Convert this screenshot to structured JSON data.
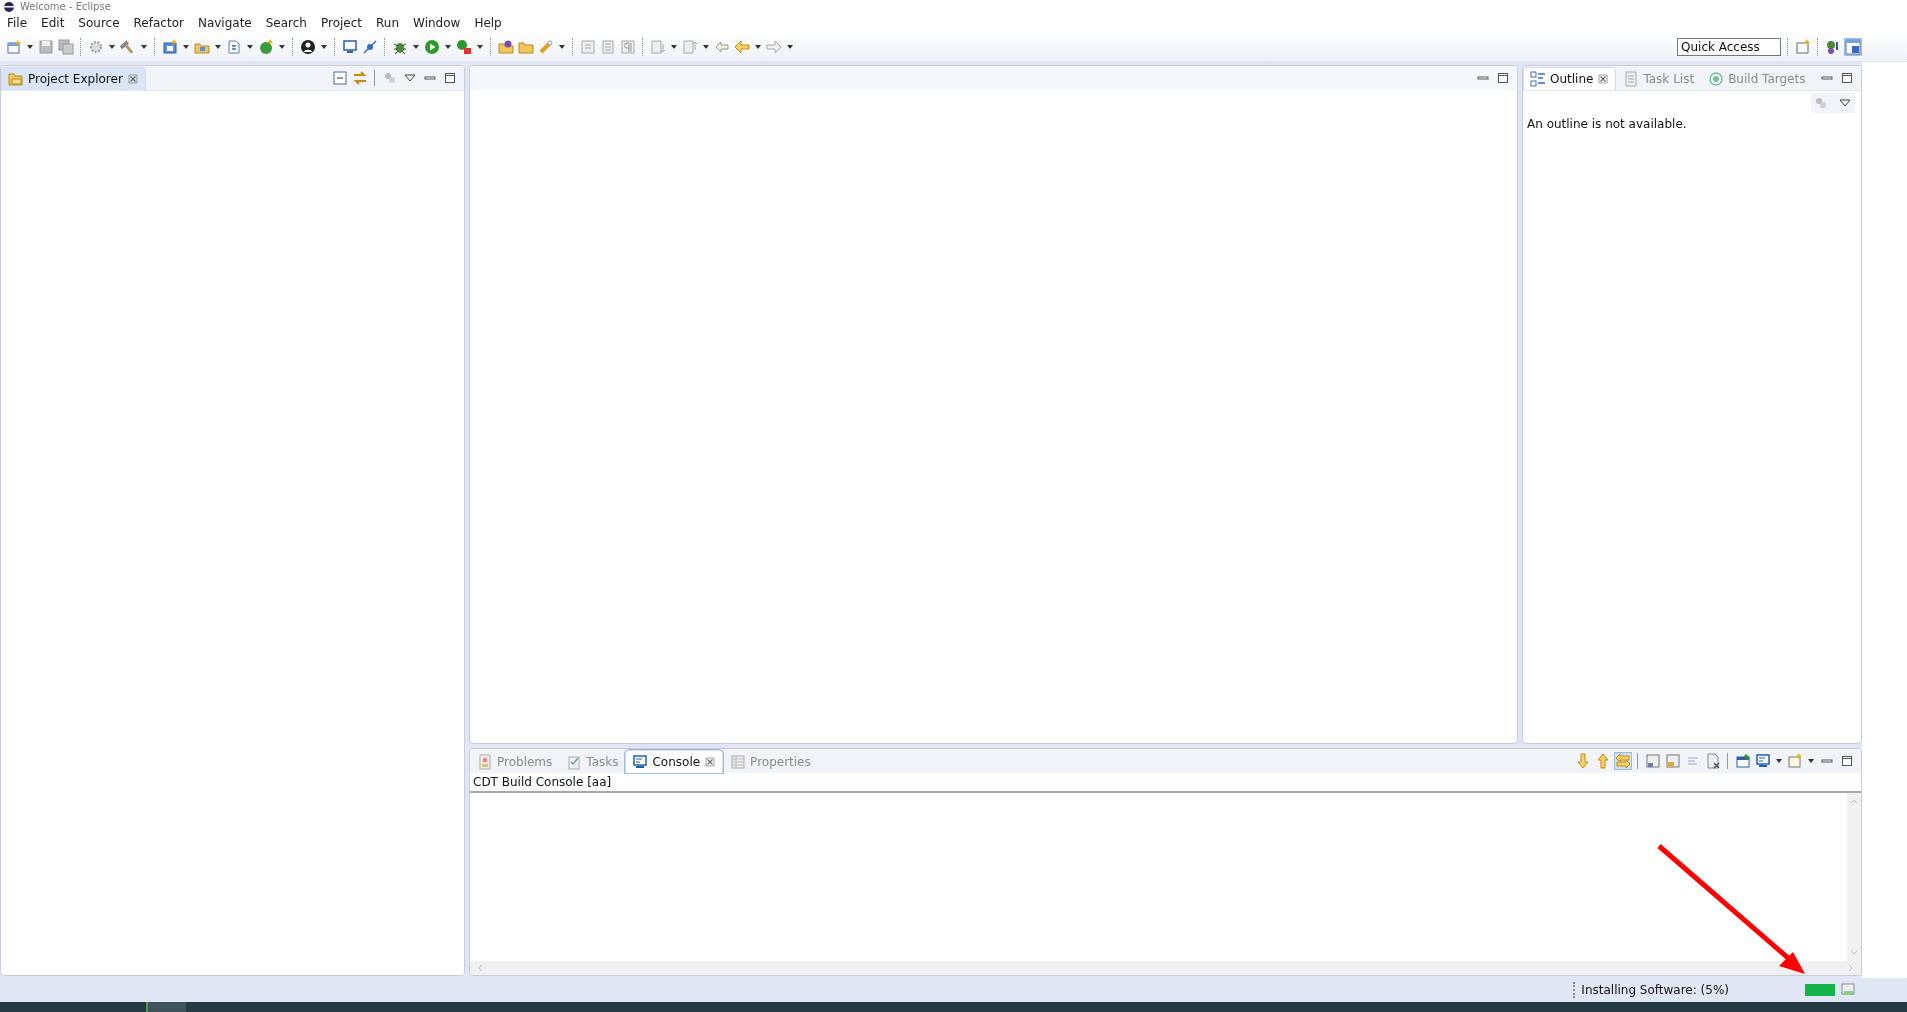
{
  "window": {
    "title": "Welcome - Eclipse"
  },
  "menu": [
    "File",
    "Edit",
    "Source",
    "Refactor",
    "Navigate",
    "Search",
    "Project",
    "Run",
    "Window",
    "Help"
  ],
  "quick_access": {
    "placeholder": "Quick Access"
  },
  "project_explorer": {
    "tabs": [
      {
        "label": "Project Explorer",
        "selected": true
      }
    ]
  },
  "outline": {
    "tabs": [
      {
        "label": "Outline",
        "selected": true
      },
      {
        "label": "Task List",
        "selected": false
      },
      {
        "label": "Build Targets",
        "selected": false
      }
    ],
    "message": "An outline is not available."
  },
  "console": {
    "tabs": [
      {
        "label": "Problems",
        "selected": false
      },
      {
        "label": "Tasks",
        "selected": false
      },
      {
        "label": "Console",
        "selected": true
      },
      {
        "label": "Properties",
        "selected": false
      }
    ],
    "title": "CDT Build Console [aa]"
  },
  "status_bar": {
    "message": "Installing Software: (5%)"
  }
}
